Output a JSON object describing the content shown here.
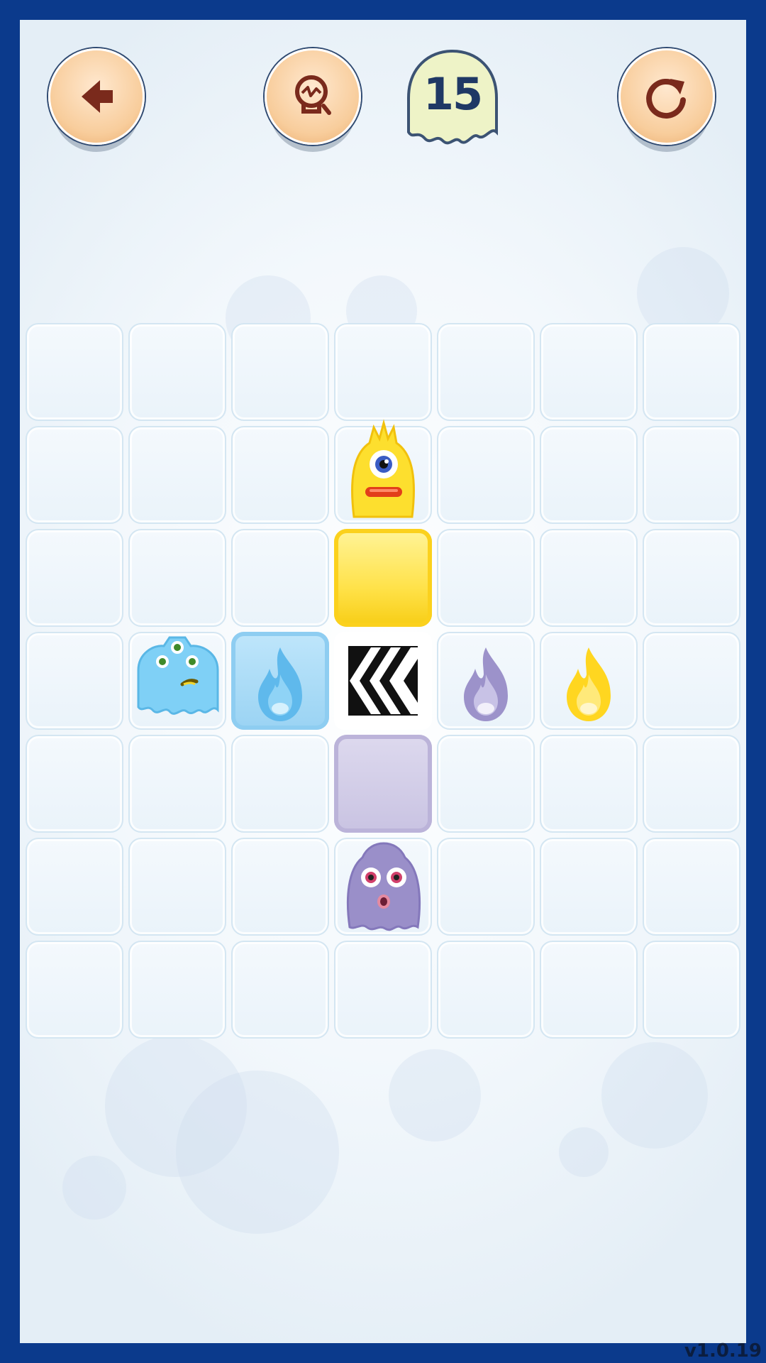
{
  "topbar": {
    "back_icon": "back-arrow-icon",
    "hint_icon": "lightbulb-icon",
    "moves_left": "15",
    "restart_icon": "restart-icon"
  },
  "board": {
    "columns": 7,
    "rows": 7,
    "pieces": [
      {
        "kind": "yellow-monster",
        "row": 1,
        "col": 3
      },
      {
        "kind": "yellow-block",
        "row": 2,
        "col": 3
      },
      {
        "kind": "blue-monster",
        "row": 3,
        "col": 1
      },
      {
        "kind": "blue-flame-block",
        "row": 3,
        "col": 2
      },
      {
        "kind": "arrow-conveyor-left",
        "row": 3,
        "col": 3
      },
      {
        "kind": "purple-flame",
        "row": 3,
        "col": 4
      },
      {
        "kind": "yellow-flame",
        "row": 3,
        "col": 5
      },
      {
        "kind": "purple-block",
        "row": 4,
        "col": 3
      },
      {
        "kind": "purple-monster",
        "row": 5,
        "col": 3
      }
    ]
  },
  "colors": {
    "frame": "#0b3a8c",
    "yellow": "#ffe24a",
    "blue": "#7fd0f6",
    "purple": "#9a8fc9",
    "button": "#f8cd9c"
  },
  "version": "v1.0.19"
}
